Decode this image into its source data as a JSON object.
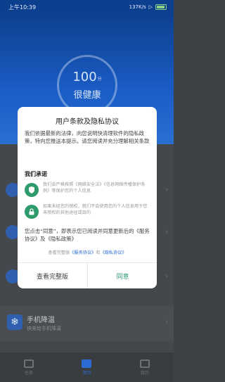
{
  "status_bar": {
    "time": "上午10:39",
    "network_speed": "137K/s",
    "battery_label": "60"
  },
  "score": {
    "value": "100",
    "unit": "分",
    "status": "很健康"
  },
  "dialog": {
    "title": "用户条款及隐私协议",
    "intro": "我们依据最新的法律，向您说明快清理软件的隐私政策，特向您推送本提示。请您阅读并充分理解相关条款",
    "section_title": "我们承诺",
    "promises": [
      {
        "icon": "shield-icon",
        "text": "我们会严格按照《网络安全法》《信息网络传播保护条例》等保护您的个人信息"
      },
      {
        "icon": "lock-icon",
        "text": "如果未经您的授权，我们不会使用您的个人信息用于您未授权的其他途径或目的"
      }
    ],
    "note": "您点击“同意”，即表示您已阅读并同意更新后的《服务协议》及《隐私政策》",
    "links_prefix": "查看完整版",
    "service_link": "《服务协议》",
    "links_and": "和",
    "privacy_link": "《隐私协议》",
    "view_full_label": "查看完整版",
    "agree_label": "同意"
  },
  "cool_row": {
    "title": "手机降温",
    "subtitle": "快来给手机降温"
  },
  "bottom_nav": [
    {
      "label": "任务",
      "icon": "calendar-icon"
    },
    {
      "label": "首页",
      "icon": "broom-icon"
    },
    {
      "label": "我的",
      "icon": "profile-icon"
    }
  ],
  "colors": {
    "primary_blue": "#1a5dc6",
    "accent_green": "#2b9a78"
  }
}
